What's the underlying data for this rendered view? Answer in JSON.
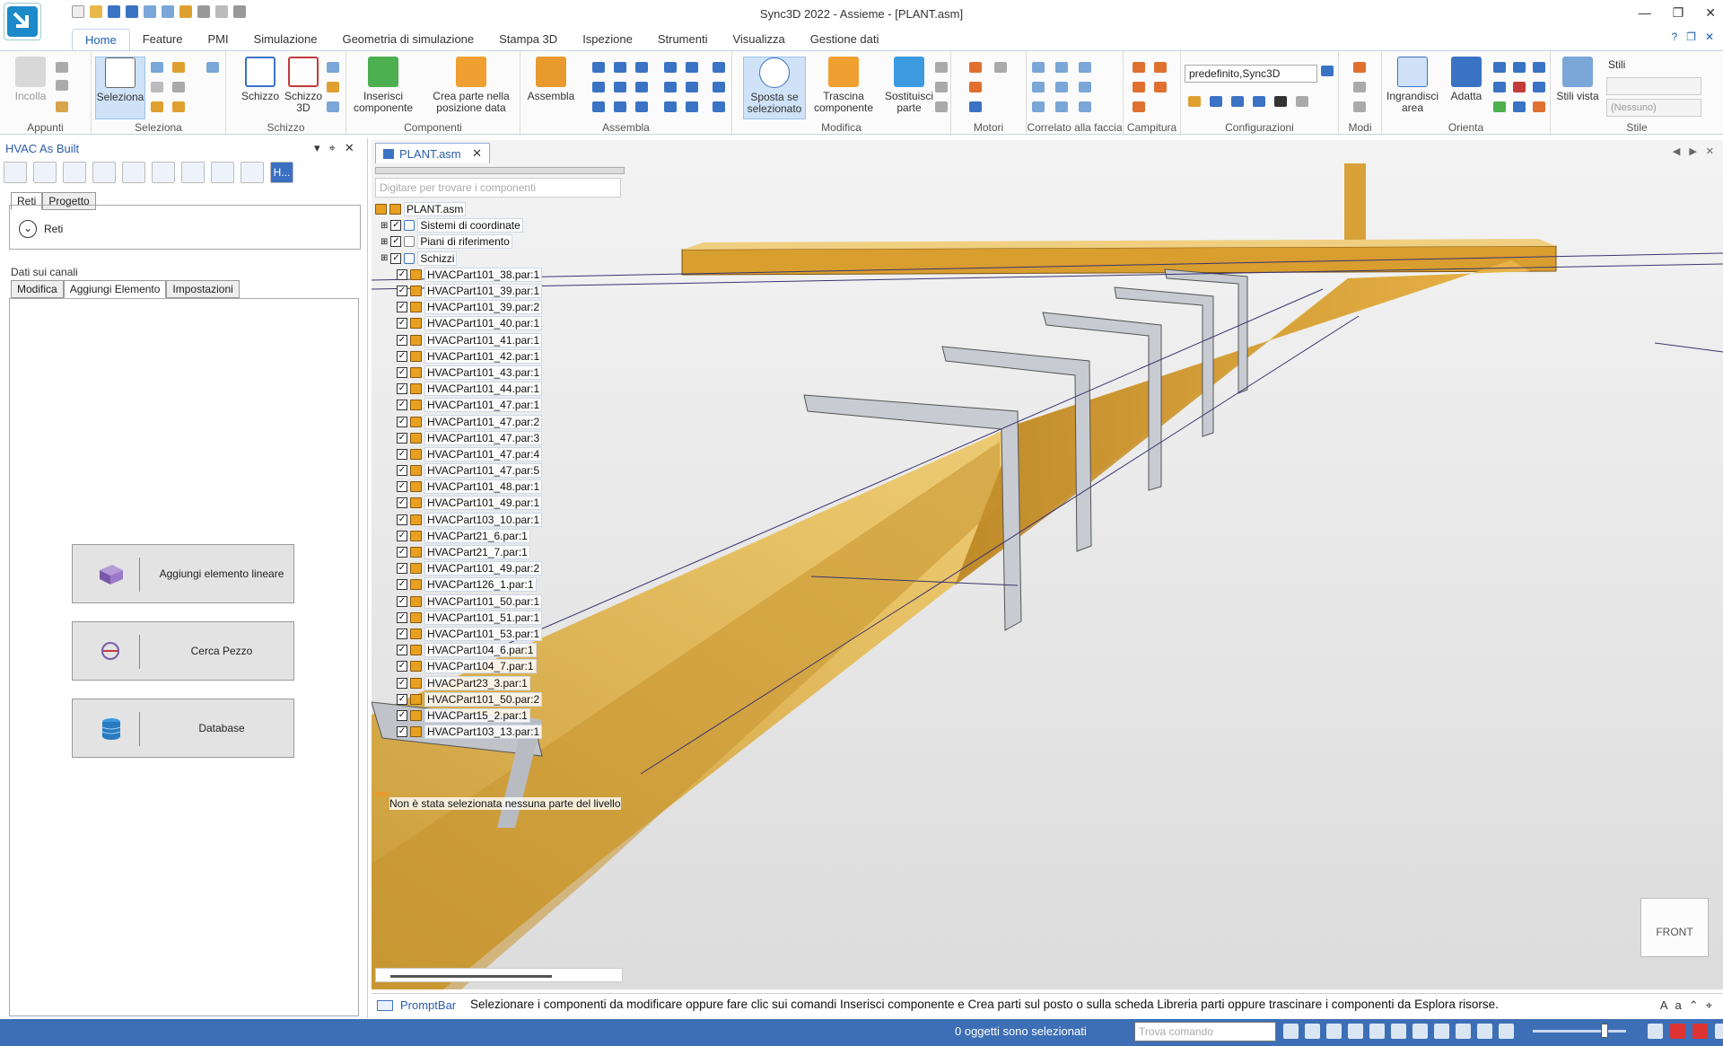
{
  "app": {
    "title": "Sync3D 2022 - Assieme - [PLANT.asm]"
  },
  "ribbon_tabs": [
    "Home",
    "Feature",
    "PMI",
    "Simulazione",
    "Geometria di simulazione",
    "Stampa 3D",
    "Ispezione",
    "Strumenti",
    "Visualizza",
    "Gestione dati"
  ],
  "ribbon": {
    "groups": {
      "appunti": "Appunti",
      "seleziona": "Seleziona",
      "schizzo": "Schizzo",
      "componenti": "Componenti",
      "assembla": "Assembla",
      "modifica": "Modifica",
      "motori": "Motori",
      "correlato": "Correlato alla faccia",
      "campitura": "Campitura",
      "configurazioni": "Configurazioni",
      "modi": "Modi",
      "orienta": "Orienta",
      "stile": "Stile"
    },
    "buttons": {
      "incolla": "Incolla",
      "seleziona": "Seleziona",
      "schizzo": "Schizzo",
      "schizzo3d": "Schizzo 3D",
      "inserisci": "Inserisci componente",
      "crea_parte": "Crea parte nella posizione data",
      "assembla": "Assembla",
      "sposta": "Sposta se selezionato",
      "trascina": "Trascina componente",
      "sostituisci": "Sostituisci parte",
      "ingrandisci": "Ingrandisci area",
      "adatta": "Adatta",
      "stili_vista": "Stili vista",
      "stili": "Stili"
    },
    "config_value": "predefinito,Sync3D",
    "style_value": "(Nessuno)"
  },
  "left_panel": {
    "title": "HVAC As Built",
    "tool_last": "H...",
    "tabs": [
      "Reti",
      "Progetto"
    ],
    "reti_label": "Reti",
    "dati_header": "Dati sui canali",
    "dati_tabs": [
      "Modifica",
      "Aggiungi Elemento",
      "Impostazioni"
    ],
    "buttons": {
      "add_linear": "Aggiungi elemento lineare",
      "find_piece": "Cerca Pezzo",
      "database": "Database"
    }
  },
  "doc_tab": "PLANT.asm",
  "tree": {
    "search_placeholder": "Digitare per trovare i componenti",
    "root": "PLANT.asm",
    "folders": [
      "Sistemi di coordinate",
      "Piani di riferimento",
      "Schizzi"
    ],
    "items": [
      "HVACPart101_38.par:1",
      "HVACPart101_39.par:1",
      "HVACPart101_39.par:2",
      "HVACPart101_40.par:1",
      "HVACPart101_41.par:1",
      "HVACPart101_42.par:1",
      "HVACPart101_43.par:1",
      "HVACPart101_44.par:1",
      "HVACPart101_47.par:1",
      "HVACPart101_47.par:2",
      "HVACPart101_47.par:3",
      "HVACPart101_47.par:4",
      "HVACPart101_47.par:5",
      "HVACPart101_48.par:1",
      "HVACPart101_49.par:1",
      "HVACPart103_10.par:1",
      "HVACPart21_6.par:1",
      "HVACPart21_7.par:1",
      "HVACPart101_49.par:2",
      "HVACPart126_1.par:1",
      "HVACPart101_50.par:1",
      "HVACPart101_51.par:1",
      "HVACPart101_53.par:1",
      "HVACPart104_6.par:1",
      "HVACPart104_7.par:1",
      "HVACPart23_3.par:1",
      "HVACPart101_50.par:2",
      "HVACPart15_2.par:1",
      "HVACPart103_13.par:1"
    ],
    "status": "Non è stata selezionata nessuna parte del livello"
  },
  "viewport": {
    "navcube": "FRONT"
  },
  "prompt": {
    "label": "PromptBar",
    "text": "Selezionare i componenti da modificare oppure fare clic sui comandi Inserisci componente e Crea parti sul posto o sulla scheda Libreria parti oppure trascinare i componenti da Esplora risorse."
  },
  "status_bar": {
    "selection": "0 oggetti sono selezionati",
    "find_placeholder": "Trova comando"
  }
}
